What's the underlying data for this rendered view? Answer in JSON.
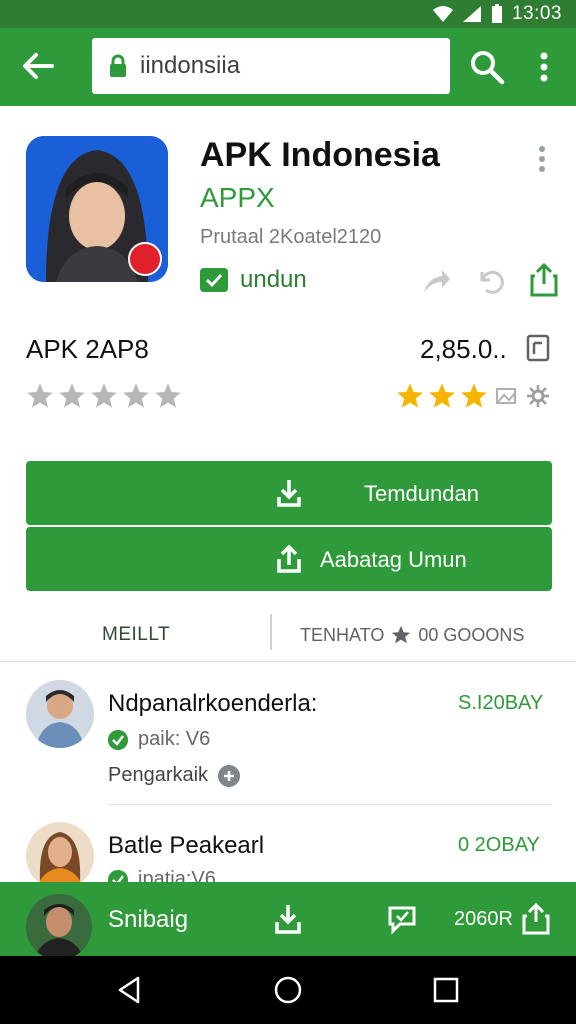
{
  "status_bar": {
    "time": "13:03"
  },
  "app_bar": {
    "back_icon": "arrow-left-icon",
    "url_text": "iindonsiia",
    "lock_icon": "lock-icon",
    "search_icon": "search-icon",
    "more_icon": "more-vert-icon"
  },
  "app": {
    "title": "APK Indonesia",
    "developer": "APPX",
    "meta": "Prutaal 2Koatel2120",
    "tag_label": "undun"
  },
  "stats": {
    "name": "APK 2AP8",
    "count": "2,85.0..",
    "left_stars": 0,
    "right_stars": 3
  },
  "buttons": {
    "primary_label": "Temdundan",
    "secondary_label": "Aabatag Umun"
  },
  "tabs": {
    "left": "MEILLT",
    "right_a": "TENHATO",
    "right_b": "00 GOOONS"
  },
  "reviews": [
    {
      "name": "Ndpanalrkoenderla:",
      "date": "S.I20BAY",
      "sub": "paik: V6",
      "text": "Pengarkaik"
    },
    {
      "name": "Batle Peakearl",
      "date": "0 2OBAY",
      "sub": "ipatia:V6",
      "text": ""
    }
  ],
  "bottom_bar": {
    "label": "Snibaig",
    "count": "2060R"
  },
  "colors": {
    "primary": "#2e9a3a",
    "dark": "#2e7d32",
    "star": "#f4b400"
  }
}
